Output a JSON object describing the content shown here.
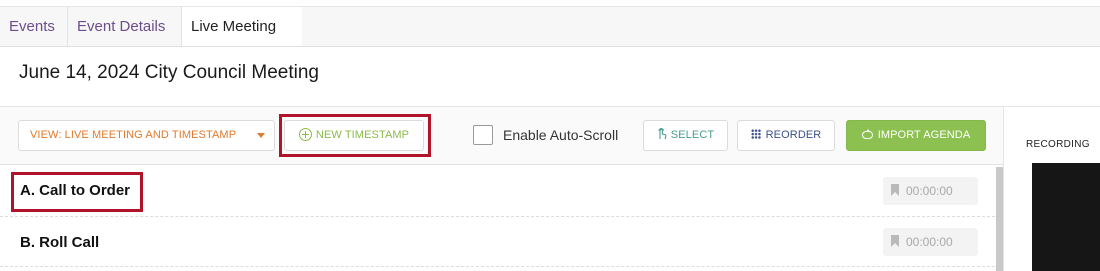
{
  "breadcrumbs": [
    {
      "label": "Events"
    },
    {
      "label": "Event Details"
    },
    {
      "label": "Live Meeting"
    }
  ],
  "page_title": "June 14, 2024 City Council Meeting",
  "toolbar": {
    "view_label": "VIEW: LIVE MEETING AND TIMESTAMP",
    "new_timestamp_label": "NEW TIMESTAMP",
    "auto_scroll_label": "Enable Auto-Scroll",
    "auto_scroll_checked": false,
    "select_label": "SELECT",
    "reorder_label": "REORDER",
    "import_label": "IMPORT AGENDA"
  },
  "recording": {
    "label": "RECORDING"
  },
  "agenda_items": [
    {
      "label": "A. Call to Order",
      "timestamp": "00:00:00"
    },
    {
      "label": "B. Roll Call",
      "timestamp": "00:00:00"
    }
  ],
  "icons": [
    "plus-circle-icon",
    "touch-icon",
    "grid-icon",
    "cloud-upload-icon",
    "bookmark-icon",
    "caret-down-icon"
  ],
  "colors": {
    "breadcrumb_link": "#6d4d8c",
    "view_orange": "#e07b2e",
    "new_timestamp_green": "#8cbb4a",
    "select_teal": "#4a9d8e",
    "reorder_navy": "#3b4f8a",
    "import_green": "#8cc152",
    "highlight_red": "#b1142a"
  }
}
